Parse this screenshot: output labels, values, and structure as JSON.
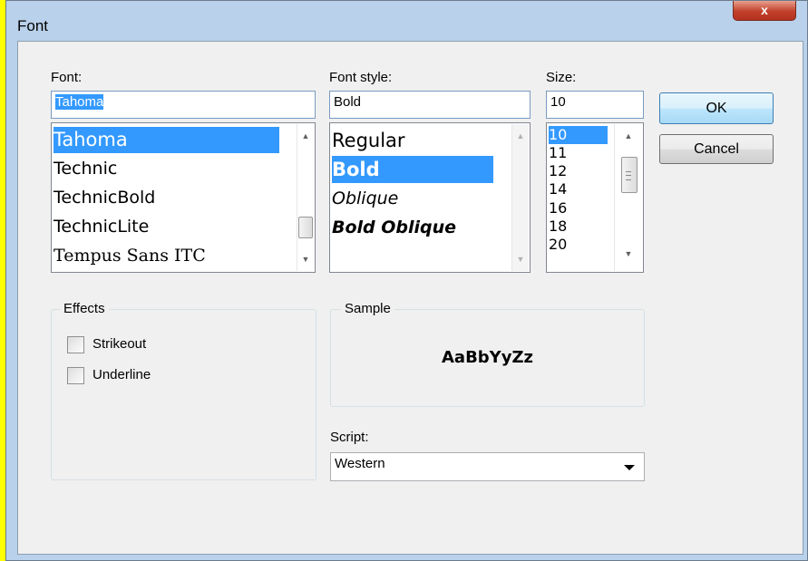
{
  "window": {
    "title": "Font",
    "close_glyph": "x"
  },
  "font": {
    "label": "Font:",
    "value": "Tahoma",
    "items": [
      {
        "label": "Tahoma",
        "selected": true
      },
      {
        "label": "Technic",
        "selected": false
      },
      {
        "label": "TechnicBold",
        "selected": false
      },
      {
        "label": "TechnicLite",
        "selected": false
      },
      {
        "label": "Tempus Sans ITC",
        "selected": false
      }
    ]
  },
  "font_style": {
    "label": "Font style:",
    "value": "Bold",
    "items": [
      {
        "label": "Regular",
        "selected": false
      },
      {
        "label": "Bold",
        "selected": true
      },
      {
        "label": "Oblique",
        "selected": false
      },
      {
        "label": "Bold Oblique",
        "selected": false
      }
    ]
  },
  "size": {
    "label": "Size:",
    "value": "10",
    "items": [
      {
        "label": "10",
        "selected": true
      },
      {
        "label": "11",
        "selected": false
      },
      {
        "label": "12",
        "selected": false
      },
      {
        "label": "14",
        "selected": false
      },
      {
        "label": "16",
        "selected": false
      },
      {
        "label": "18",
        "selected": false
      },
      {
        "label": "20",
        "selected": false
      }
    ]
  },
  "buttons": {
    "ok": "OK",
    "cancel": "Cancel"
  },
  "effects": {
    "title": "Effects",
    "strikeout": {
      "label": "Strikeout",
      "checked": false
    },
    "underline": {
      "label": "Underline",
      "checked": false
    }
  },
  "sample": {
    "title": "Sample",
    "text": "AaBbYyZz"
  },
  "script": {
    "label": "Script:",
    "value": "Western"
  },
  "icons": {
    "scroll_up": "▲",
    "scroll_down": "▼",
    "close": "close-icon",
    "combo": "chevron-down-icon"
  }
}
